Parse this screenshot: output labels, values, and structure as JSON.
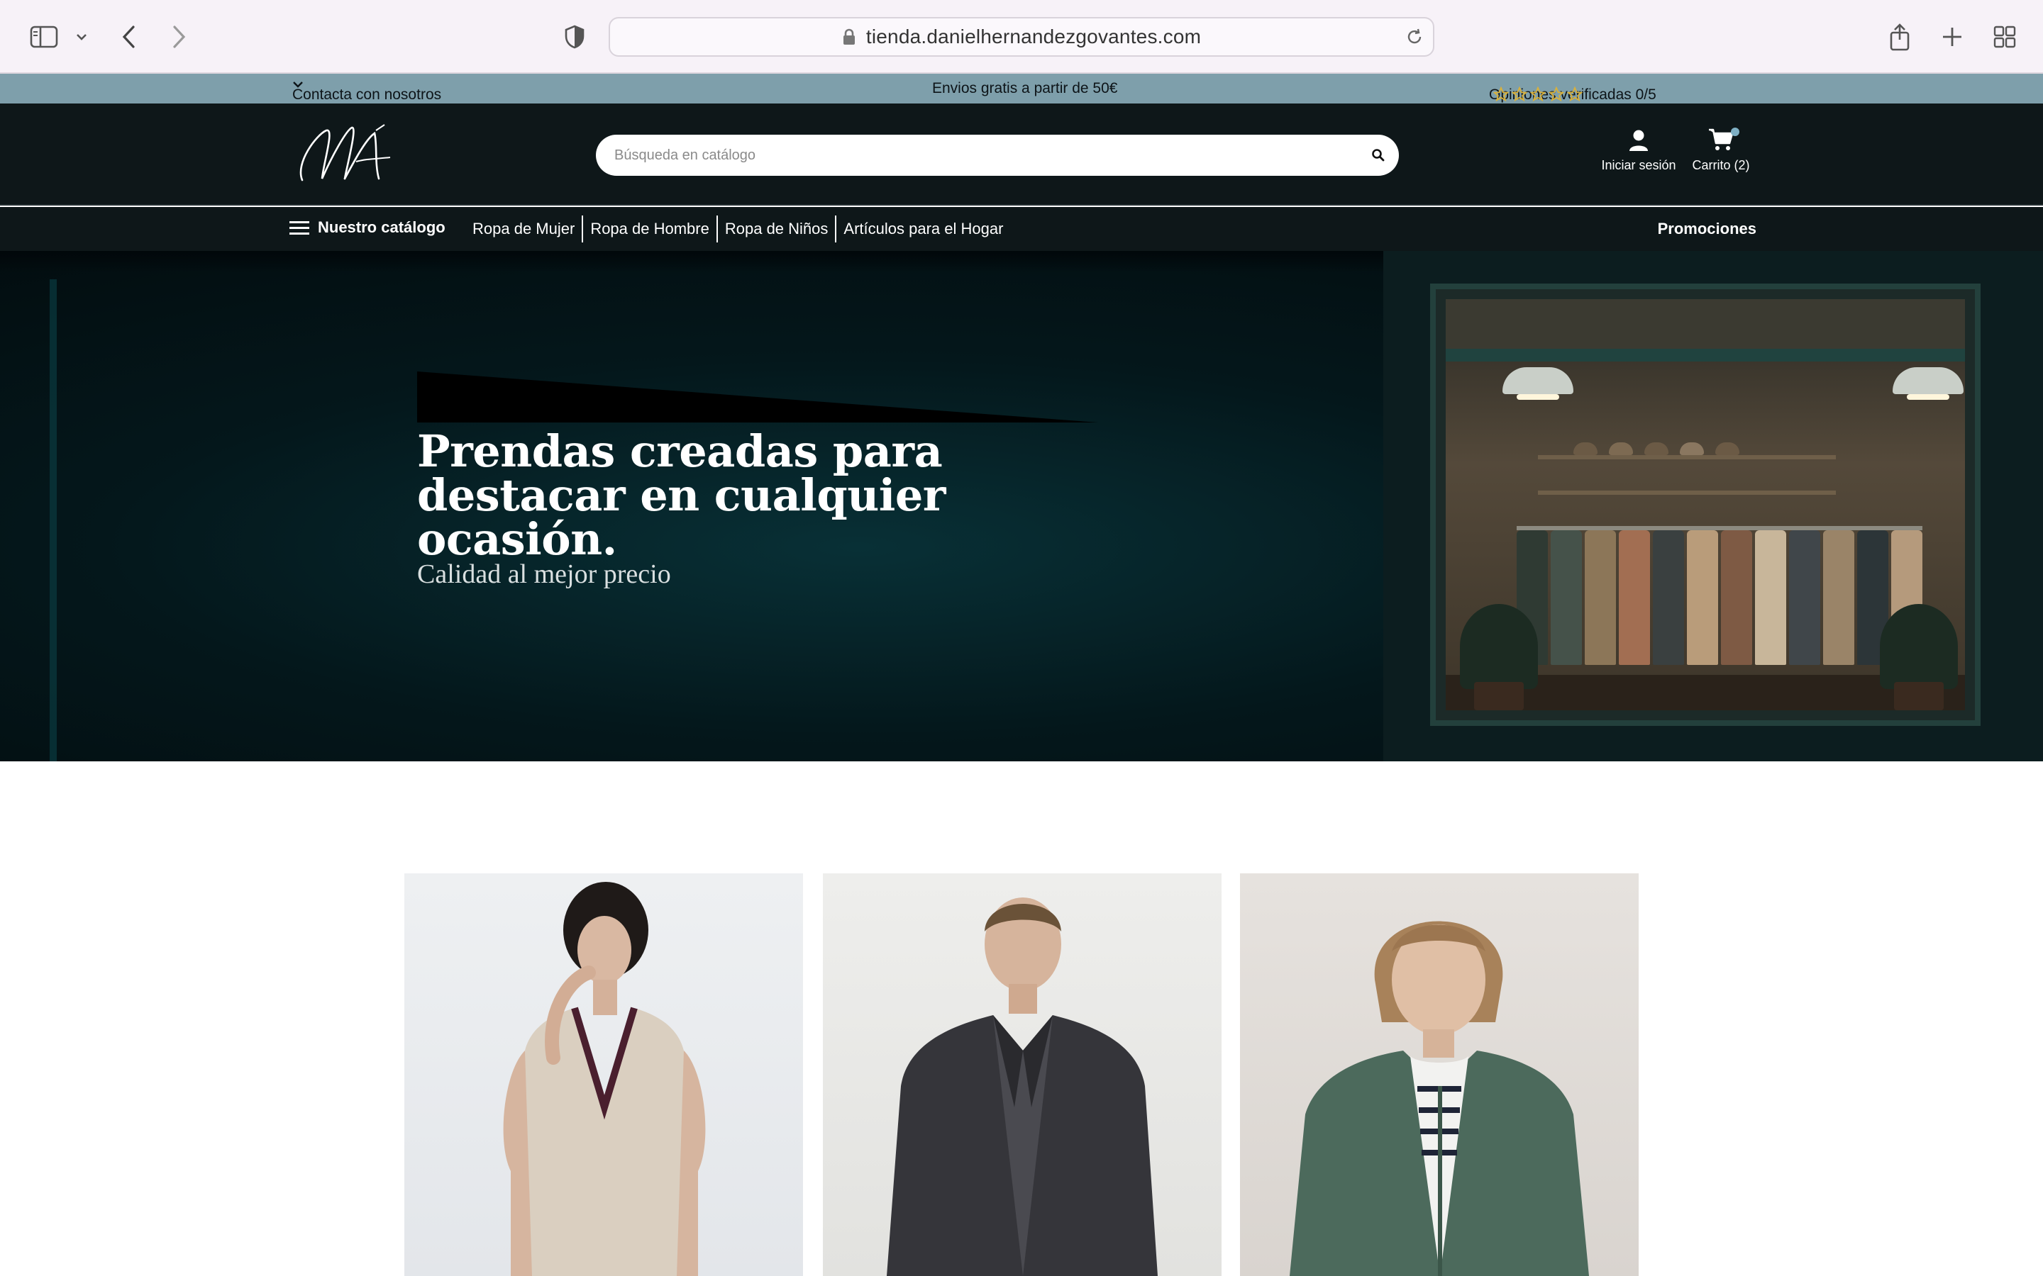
{
  "browser": {
    "url": "tienda.danielhernandezgovantes.com",
    "icons": [
      "sidebar-icon",
      "chevron-down-icon",
      "back-icon",
      "forward-icon",
      "shield-icon",
      "lock-icon",
      "reload-icon",
      "share-icon",
      "new-tab-icon",
      "tab-overview-icon"
    ]
  },
  "info_strip": {
    "contact": "Contacta con nosotros",
    "shipping": "Envios gratis a partir de 50€",
    "reviews": "Opiniones verificadas 0/5",
    "rating": 0,
    "rating_max": 5
  },
  "header": {
    "search_placeholder": "Búsqueda en catálogo",
    "login": "Iniciar sesión",
    "cart": "Carrito (2)"
  },
  "nav": {
    "catalog": "Nuestro catálogo",
    "links": [
      "Ropa de Mujer",
      "Ropa de Hombre",
      "Ropa de Niños",
      "Artículos para el Hogar"
    ],
    "promotions": "Promociones"
  },
  "hero": {
    "title": "Prendas creadas para destacar en cualquier ocasión.",
    "subtitle": "Calidad al mejor precio"
  },
  "categories": [
    "women",
    "men",
    "kids"
  ],
  "colors": {
    "info_strip": "#7e9fab",
    "header": "#0e1719",
    "star": "#d9b13b",
    "hero": "#04171b"
  }
}
